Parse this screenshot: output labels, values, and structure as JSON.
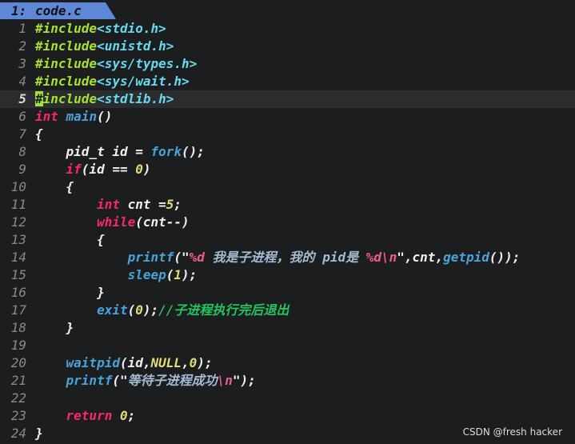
{
  "tab": {
    "number": "1:",
    "filename": "code.c"
  },
  "colors": {
    "background": "#1b1d1e",
    "tab": "#5f87d7",
    "preprocessor": "#a6e22e",
    "keyword": "#f92672",
    "function": "#4aa3d8",
    "number": "#e6db74",
    "comment": "#22c55e",
    "cursor": "#9fe03b"
  },
  "editor": {
    "current_line": 5,
    "lines": [
      {
        "n": "1",
        "tokens": [
          [
            "pp",
            "#include"
          ],
          [
            "inc",
            "<stdio.h>"
          ]
        ]
      },
      {
        "n": "2",
        "tokens": [
          [
            "pp",
            "#include"
          ],
          [
            "inc",
            "<unistd.h>"
          ]
        ]
      },
      {
        "n": "3",
        "tokens": [
          [
            "pp",
            "#include"
          ],
          [
            "inc",
            "<sys/types.h>"
          ]
        ]
      },
      {
        "n": "4",
        "tokens": [
          [
            "pp",
            "#include"
          ],
          [
            "inc",
            "<sys/wait.h>"
          ]
        ]
      },
      {
        "n": "5",
        "tokens": [
          [
            "cursor",
            "#"
          ],
          [
            "pp",
            "include"
          ],
          [
            "inc",
            "<stdlib.h>"
          ]
        ]
      },
      {
        "n": "6",
        "tokens": [
          [
            "kw",
            "int"
          ],
          [
            "plain",
            " "
          ],
          [
            "fn",
            "main"
          ],
          [
            "plain",
            "()"
          ]
        ]
      },
      {
        "n": "7",
        "tokens": [
          [
            "plain",
            "{"
          ]
        ]
      },
      {
        "n": "8",
        "tokens": [
          [
            "plain",
            "    pid_t id = "
          ],
          [
            "fn",
            "fork"
          ],
          [
            "plain",
            "();"
          ]
        ]
      },
      {
        "n": "9",
        "tokens": [
          [
            "plain",
            "    "
          ],
          [
            "kw",
            "if"
          ],
          [
            "plain",
            "(id == "
          ],
          [
            "num",
            "0"
          ],
          [
            "plain",
            ")"
          ]
        ]
      },
      {
        "n": "10",
        "tokens": [
          [
            "plain",
            "    {"
          ]
        ]
      },
      {
        "n": "11",
        "tokens": [
          [
            "plain",
            "        "
          ],
          [
            "kw",
            "int"
          ],
          [
            "plain",
            " cnt ="
          ],
          [
            "num",
            "5"
          ],
          [
            "plain",
            ";"
          ]
        ]
      },
      {
        "n": "12",
        "tokens": [
          [
            "plain",
            "        "
          ],
          [
            "kw",
            "while"
          ],
          [
            "plain",
            "(cnt--)"
          ]
        ]
      },
      {
        "n": "13",
        "tokens": [
          [
            "plain",
            "        {"
          ]
        ]
      },
      {
        "n": "14",
        "tokens": [
          [
            "plain",
            "            "
          ],
          [
            "fn",
            "printf"
          ],
          [
            "plain",
            "(\""
          ],
          [
            "fmt",
            "%d"
          ],
          [
            "str",
            " 我是子进程，我的 pid是 "
          ],
          [
            "fmt",
            "%d\\n"
          ],
          [
            "plain",
            "\",cnt,"
          ],
          [
            "fn",
            "getpid"
          ],
          [
            "plain",
            "());"
          ]
        ]
      },
      {
        "n": "15",
        "tokens": [
          [
            "plain",
            "            "
          ],
          [
            "fn",
            "sleep"
          ],
          [
            "plain",
            "("
          ],
          [
            "num",
            "1"
          ],
          [
            "plain",
            ");"
          ]
        ]
      },
      {
        "n": "16",
        "tokens": [
          [
            "plain",
            "        }"
          ]
        ]
      },
      {
        "n": "17",
        "tokens": [
          [
            "plain",
            "        "
          ],
          [
            "fn",
            "exit"
          ],
          [
            "plain",
            "("
          ],
          [
            "num",
            "0"
          ],
          [
            "plain",
            ");"
          ],
          [
            "cmt",
            "//子进程执行完后退出"
          ]
        ]
      },
      {
        "n": "18",
        "tokens": [
          [
            "plain",
            "    }"
          ]
        ]
      },
      {
        "n": "19",
        "tokens": []
      },
      {
        "n": "20",
        "tokens": [
          [
            "plain",
            "    "
          ],
          [
            "fn",
            "waitpid"
          ],
          [
            "plain",
            "(id,"
          ],
          [
            "num",
            "NULL"
          ],
          [
            "plain",
            ","
          ],
          [
            "num",
            "0"
          ],
          [
            "plain",
            ");"
          ]
        ]
      },
      {
        "n": "21",
        "tokens": [
          [
            "plain",
            "    "
          ],
          [
            "fn",
            "printf"
          ],
          [
            "plain",
            "(\""
          ],
          [
            "str",
            "等待子进程成功"
          ],
          [
            "fmt",
            "\\n"
          ],
          [
            "plain",
            "\");"
          ]
        ]
      },
      {
        "n": "22",
        "tokens": []
      },
      {
        "n": "23",
        "tokens": [
          [
            "plain",
            "    "
          ],
          [
            "kw",
            "return"
          ],
          [
            "plain",
            " "
          ],
          [
            "num",
            "0"
          ],
          [
            "plain",
            ";"
          ]
        ]
      },
      {
        "n": "24",
        "tokens": [
          [
            "plain",
            "}"
          ]
        ]
      }
    ]
  },
  "watermark": "CSDN @fresh hacker"
}
